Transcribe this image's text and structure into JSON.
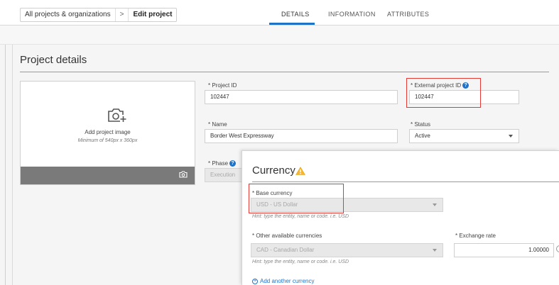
{
  "header": {
    "breadcrumb_root": "All projects & organizations",
    "breadcrumb_separator": ">",
    "breadcrumb_current": "Edit project",
    "tabs": [
      {
        "label": "DETAILS",
        "active": true
      },
      {
        "label": "INFORMATION",
        "active": false
      },
      {
        "label": "ATTRIBUTES",
        "active": false
      }
    ],
    "accent_color": "#1e73c6"
  },
  "project_details": {
    "title": "Project details",
    "image": {
      "icon": "add-photo-icon",
      "add_label": "Add project image",
      "min_label": "Minimum of 540px x 360px",
      "bar_icon": "camera-icon"
    },
    "project_id": {
      "label": "* Project ID",
      "value": "102447"
    },
    "external_project_id": {
      "label": "* External project ID",
      "value": "102447",
      "help_icon": "help-icon"
    },
    "name": {
      "label": "* Name",
      "value": "Border West Expressway"
    },
    "status": {
      "label": "* Status",
      "value": "Active"
    },
    "phase": {
      "label": "* Phase",
      "value": "Execution",
      "help_icon": "help-icon"
    }
  },
  "currency": {
    "title": "Currency",
    "warning_icon": "warning-icon",
    "base_currency": {
      "label": "* Base currency",
      "value": "USD - US Dollar",
      "hint": "Hint: type the entity, name or code. i.e. USD"
    },
    "other_currencies": {
      "label": "* Other available currencies",
      "value": "CAD - Canadian Dollar",
      "hint": "Hint: type the entity, name or code. i.e. USD"
    },
    "exchange_rate": {
      "label": "* Exchange rate",
      "value": "1.00000"
    },
    "add_another_label": "Add another currency"
  },
  "highlight_color": "#e53935"
}
